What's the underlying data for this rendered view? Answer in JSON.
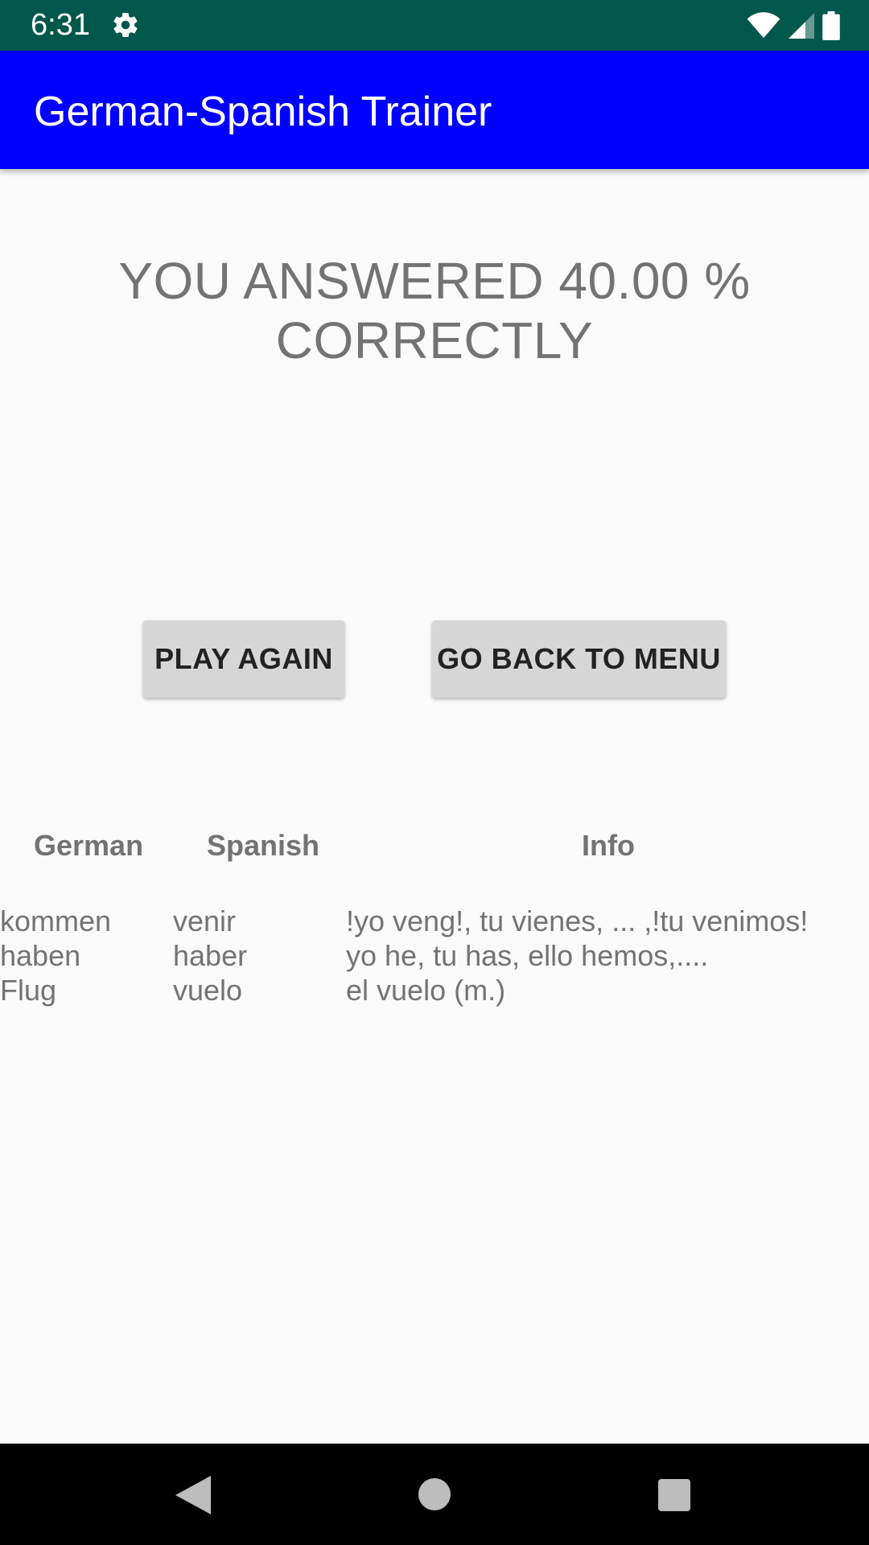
{
  "status_bar": {
    "time": "6:31",
    "icons": [
      "gear-icon",
      "wifi-icon",
      "signal-icon",
      "battery-icon"
    ]
  },
  "app_bar": {
    "title": "German-Spanish Trainer",
    "color": "#0000ff"
  },
  "result": {
    "text": "YOU ANSWERED 40.00 % CORRECTLY"
  },
  "buttons": {
    "play_again": "PLAY AGAIN",
    "go_back_to_menu": "GO BACK TO MENU"
  },
  "table": {
    "headers": [
      "German",
      "Spanish",
      "Info"
    ],
    "rows": [
      {
        "german": "kommen",
        "spanish": "venir",
        "info": "!yo veng!, tu vienes, ... ,!tu venimos!"
      },
      {
        "german": "haben",
        "spanish": "haber",
        "info": "yo he, tu has, ello hemos,...."
      },
      {
        "german": "Flug",
        "spanish": "vuelo",
        "info": "el vuelo (m.)"
      }
    ]
  },
  "nav_bar": {
    "icons": [
      "back-icon",
      "home-icon",
      "recents-icon"
    ]
  }
}
